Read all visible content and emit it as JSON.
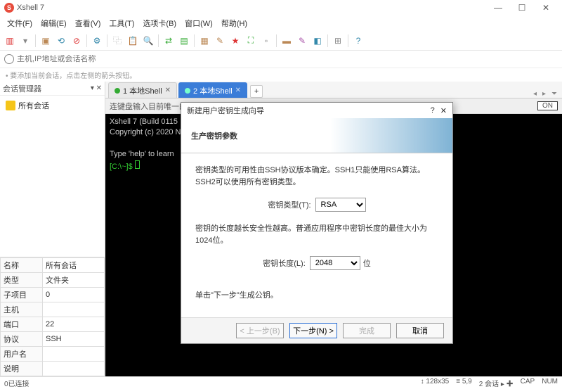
{
  "titlebar": {
    "app_name": "Xshell 7"
  },
  "menu": {
    "file": "文件(F)",
    "edit": "编辑(E)",
    "view": "查看(V)",
    "tools": "工具(T)",
    "tab": "选项卡(B)",
    "window": "窗口(W)",
    "help": "帮助(H)"
  },
  "addressbar": {
    "placeholder": "主机,IP地址或会话名称"
  },
  "hint": "• 要添加当前会话，点击左侧的箭头按钮。",
  "sidebar": {
    "title": "会话管理器",
    "root": "所有会话",
    "props": [
      {
        "k": "名称",
        "v": "所有会话"
      },
      {
        "k": "类型",
        "v": "文件夹"
      },
      {
        "k": "子项目",
        "v": "0"
      },
      {
        "k": "主机",
        "v": ""
      },
      {
        "k": "端口",
        "v": "22"
      },
      {
        "k": "协议",
        "v": "SSH"
      },
      {
        "k": "用户名",
        "v": ""
      },
      {
        "k": "说明",
        "v": ""
      }
    ]
  },
  "tabs": {
    "t1": {
      "label": "1 本地Shell"
    },
    "t2": {
      "label": "2 本地Shell"
    }
  },
  "subbar": {
    "text": "连键盘输入目前唯一的会话。",
    "on": "ON"
  },
  "terminal": {
    "line1": "Xshell 7 (Build 0115",
    "line2": "Copyright (c) 2020 N",
    "line3": "Type 'help' to learn",
    "prompt": "[C:\\~]$"
  },
  "dialog": {
    "title": "新建用户密钥生成向导",
    "header": "生产密钥参数",
    "p1": "密钥类型的可用性由SSH协议版本确定。SSH1只能使用RSA算法。SSH2可以使用所有密钥类型。",
    "key_type_label": "密钥类型(T):",
    "key_type_value": "RSA",
    "p2": "密钥的长度越长安全性越高。普通应用程序中密钥长度的最佳大小为1024位。",
    "key_len_label": "密钥长度(L):",
    "key_len_value": "2048",
    "key_len_unit": "位",
    "p3": "单击\"下一步\"生成公钥。",
    "back": "< 上一步(B)",
    "next": "下一步(N) >",
    "finish": "完成",
    "cancel": "取消"
  },
  "status": {
    "left": "0已连接",
    "dim": "128x35",
    "pos": "5,9",
    "sess": "2 会话",
    "cap": "CAP",
    "num": "NUM"
  }
}
